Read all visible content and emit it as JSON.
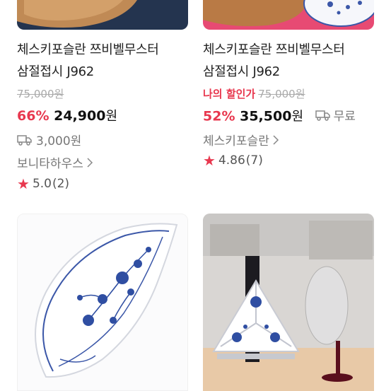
{
  "products": [
    {
      "title_line1": "체스키포슬란 쯔비벨무스터",
      "title_line2": "삼절접시 J962",
      "original_price": "75,000원",
      "discount_label": "",
      "discount_percent": "66%",
      "sale_price": "24,900",
      "currency": "원",
      "shipping": "3,000원",
      "seller": "보니타하우스",
      "rating": "5.0",
      "review_count": "(2)"
    },
    {
      "title_line1": "체스키포슬란 쯔비벨무스터",
      "title_line2": "삼절접시 J962",
      "original_price": "75,000원",
      "discount_label": "나의 할인가",
      "discount_percent": "52%",
      "sale_price": "35,500",
      "currency": "원",
      "shipping": "무료",
      "seller": "체스키포슬란",
      "rating": "4.86",
      "review_count": "(7)"
    }
  ],
  "colors": {
    "accent": "#e8384f",
    "muted": "#777777",
    "strike": "#aaaaaa"
  },
  "icons": {
    "truck": "truck-icon",
    "chevron": "chevron-right-icon",
    "star": "star-icon"
  }
}
